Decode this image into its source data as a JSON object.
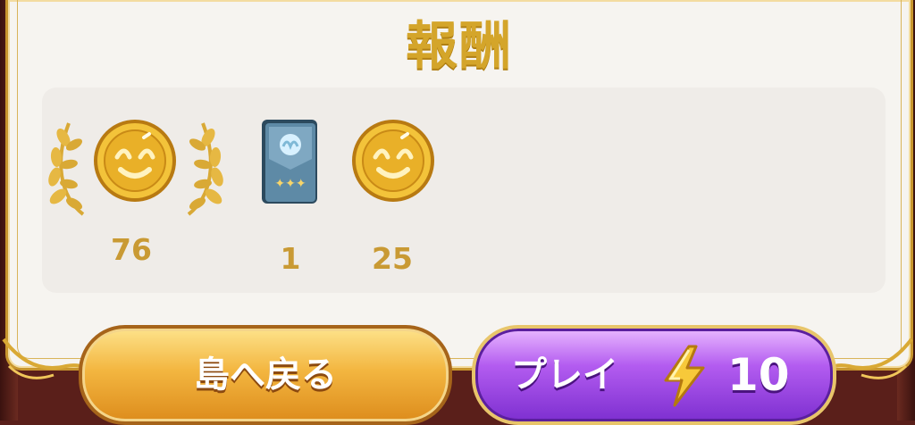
{
  "title": "報酬",
  "rewards": [
    {
      "item": "coin",
      "count": "76",
      "featured": true
    },
    {
      "item": "card-pack",
      "count": "1",
      "featured": false
    },
    {
      "item": "coin",
      "count": "25",
      "featured": false
    }
  ],
  "buttons": {
    "back_label": "島へ戻る",
    "play_label": "プレイ",
    "play_cost": "10"
  },
  "icons": {
    "coin": "coin-icon",
    "card_pack": "card-pack-icon",
    "laurel": "laurel-icon",
    "energy": "lightning-icon"
  },
  "colors": {
    "gold_text": "#d4a52a",
    "panel_bg": "#f6f4f0",
    "back_button": "#f3b640",
    "play_button": "#b35cf0"
  }
}
